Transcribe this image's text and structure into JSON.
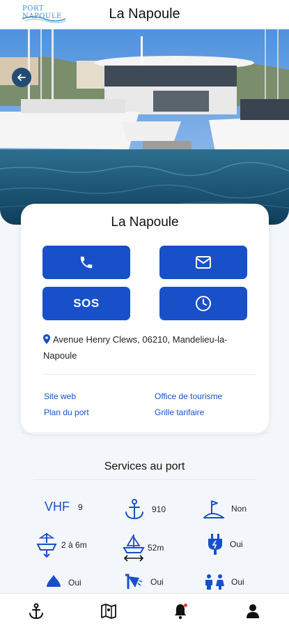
{
  "header": {
    "logo_text": "PORT NAPOULE",
    "title": "La Napoule"
  },
  "card": {
    "title": "La Napoule",
    "sos_label": "SOS",
    "address": "Avenue Henry Clews, 06210, Mandelieu-la-Napoule",
    "links": {
      "site_web": "Site web",
      "office_tourisme": "Office de tourisme",
      "plan_port": "Plan du port",
      "grille_tarifaire": "Grille tarifaire"
    }
  },
  "services": {
    "title": "Services au port",
    "vhf_label": "VHF",
    "vhf_value": "9",
    "anchor_value": "910",
    "flag_value": "Non",
    "draft_value": "2 à 6m",
    "length_value": "52m",
    "electricity_value": "Oui",
    "water_value": "Oui",
    "shower_value": "Oui",
    "toilets_value": "Oui"
  },
  "colors": {
    "primary": "#1850c9",
    "back_button": "#234b73",
    "background": "#f3f6fa"
  },
  "nav": {
    "items": [
      "anchor-icon",
      "map-icon",
      "bell-icon",
      "user-icon"
    ]
  }
}
